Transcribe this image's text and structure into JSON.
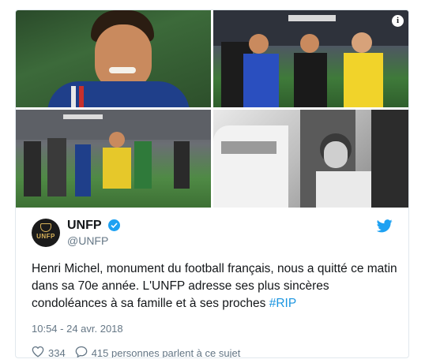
{
  "tweet": {
    "author_name": "UNFP",
    "author_handle": "@UNFP",
    "avatar_label": "UNFP",
    "text_main": "Henri Michel, monument du football français, nous a quitté ce matin dans sa 70e année. L'UNFP adresse ses plus sincères condoléances à sa famille et à ses proches ",
    "hashtag": "#RIP",
    "timestamp": "10:54 - 24 avr. 2018",
    "likes_count": "334",
    "replies_label": "415 personnes parlent à ce sujet",
    "info_icon_glyph": "i"
  },
  "icons": {
    "verified": "verified-badge-icon",
    "bird": "twitter-bird-icon",
    "heart": "heart-icon",
    "reply": "speech-bubble-icon",
    "info": "info-icon"
  },
  "colors": {
    "accent": "#1da1f2",
    "link": "#1b95e0",
    "muted": "#657786",
    "text": "#14171a",
    "border": "#e1e8ed"
  }
}
